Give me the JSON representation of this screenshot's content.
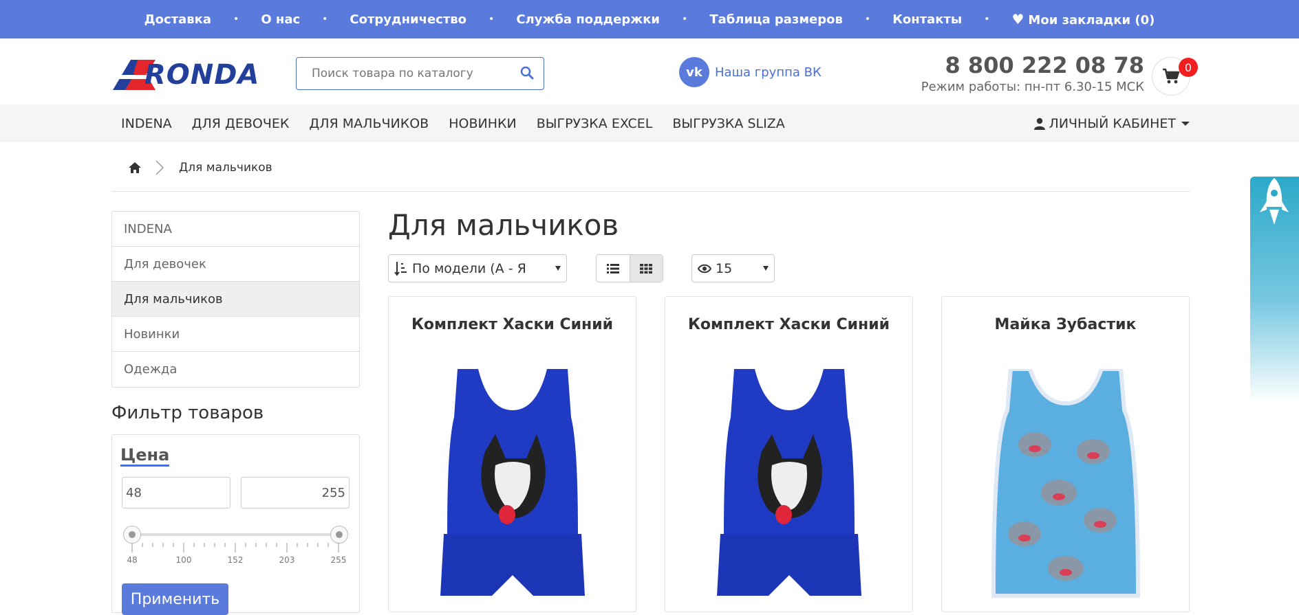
{
  "topbar": {
    "links": [
      "Доставка",
      "О нас",
      "Сотрудничество",
      "Служба поддержки",
      "Таблица размеров",
      "Контакты"
    ],
    "bookmarks": "Мои закладки (0)"
  },
  "header": {
    "logo_text": "RONDA",
    "search_placeholder": "Поиск товара по каталогу",
    "vk_label": "Наша группа ВК",
    "vk_icon_text": "vk",
    "phone": "8 800 222 08 78",
    "hours": "Режим работы: пн-пт 6.30-15 МСК",
    "cart_count": "0"
  },
  "nav": {
    "items": [
      "INDENA",
      "Для девочек",
      "Для мальчиков",
      "Новинки",
      "Выгрузка EXCEL",
      "Выгрузка SLIZA"
    ],
    "account": "ЛИЧНЫЙ КАБИНЕТ"
  },
  "breadcrumb": {
    "current": "Для мальчиков"
  },
  "sidebar": {
    "categories": [
      "INDENA",
      "Для девочек",
      "Для мальчиков",
      "Новинки",
      "Одежда"
    ],
    "active_index": 2,
    "filter_title": "Фильтр товаров",
    "price_title": "Цена",
    "price_min": "48",
    "price_max": "255",
    "ticks": [
      "48",
      "100",
      "152",
      "203",
      "255"
    ],
    "apply_label": "Применить"
  },
  "main": {
    "title": "Для мальчиков",
    "sort_label": "По модели (А - Я",
    "limit_value": "15",
    "view_mode": "grid",
    "products": [
      {
        "name": "Комплект Хаски Синий"
      },
      {
        "name": "Комплект Хаски Синий"
      },
      {
        "name": "Майка Зубастик"
      }
    ]
  },
  "colors": {
    "brand_blue": "#5b7bdc",
    "badge_red": "#f01e1e"
  }
}
